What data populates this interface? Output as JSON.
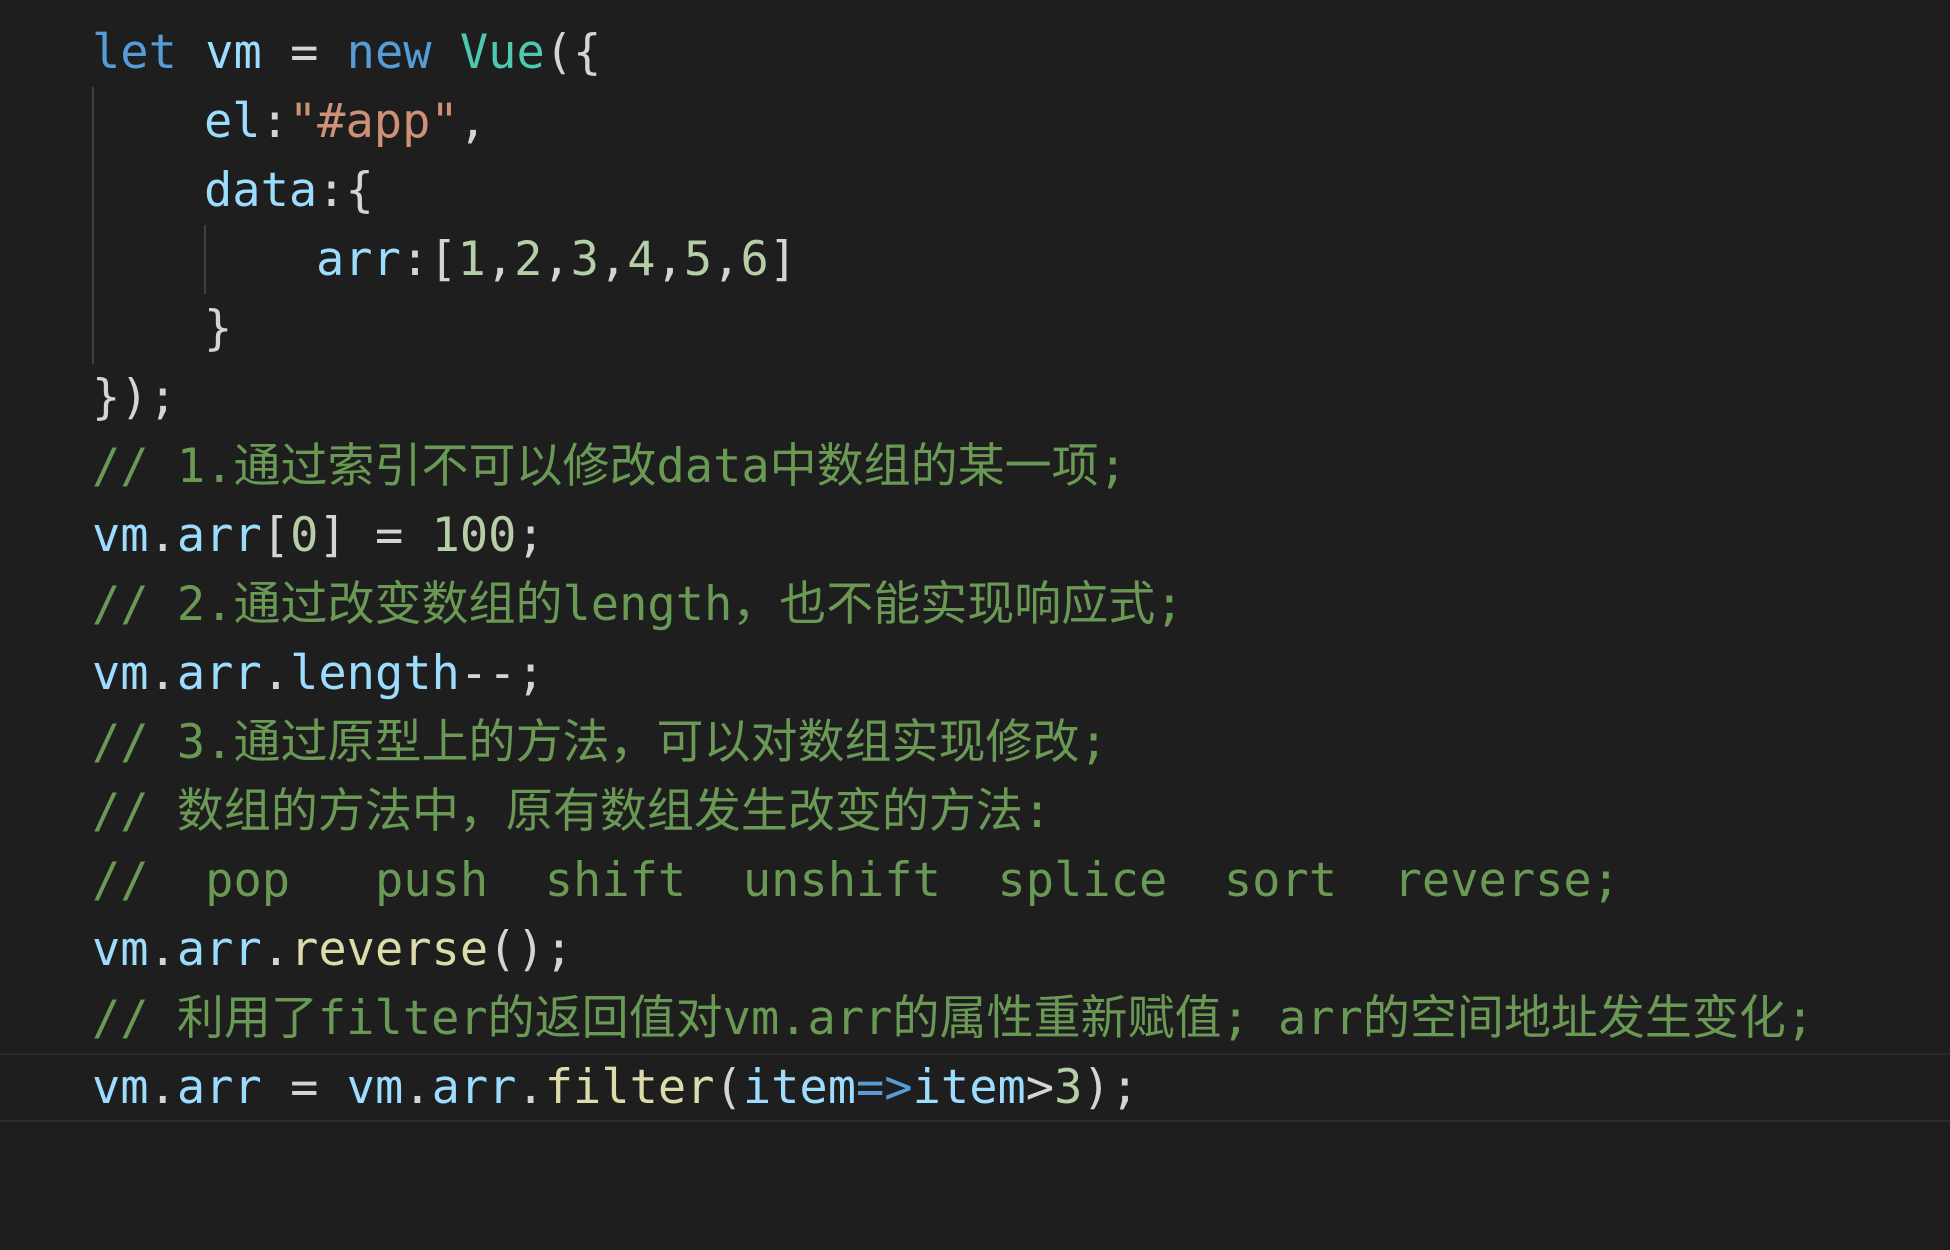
{
  "editor": {
    "theme_colors": {
      "background": "#1e1e1e",
      "keyword": "#569cd6",
      "class_name": "#4ec9b0",
      "string": "#ce9178",
      "number": "#b5cea8",
      "variable": "#9cdcfe",
      "function": "#dcdcaa",
      "comment": "#6a9955",
      "punctuation": "#d4d4d4"
    },
    "lines": {
      "l1": {
        "let": "let",
        "vm": "vm",
        "eq": " = ",
        "new": "new",
        "vue": "Vue",
        "tail": "({"
      },
      "l2": {
        "key": "el",
        "colon": ":",
        "str": "\"#app\"",
        "comma": ","
      },
      "l3": {
        "key": "data",
        "tail": ":{"
      },
      "l4": {
        "key": "arr",
        "open": ":[",
        "nums": [
          "1",
          "2",
          "3",
          "4",
          "5",
          "6"
        ],
        "sep": ",",
        "close": "]"
      },
      "l5": {
        "brace": "}"
      },
      "l6": {
        "text": "});"
      },
      "l7": {
        "comment": "// 1.通过索引不可以修改data中数组的某一项;"
      },
      "l8": {
        "vm": "vm",
        "dot": ".",
        "arr": "arr",
        "open": "[",
        "idx": "0",
        "close": "]",
        "eq": " = ",
        "val": "100",
        "semi": ";"
      },
      "l9": {
        "comment": "// 2.通过改变数组的length，也不能实现响应式;"
      },
      "l10": {
        "vm": "vm",
        "dot": ".",
        "arr": "arr",
        "dot2": ".",
        "prop": "length",
        "tail": "--;"
      },
      "l11": {
        "comment": "// 3.通过原型上的方法，可以对数组实现修改;"
      },
      "l12": {
        "comment": "// 数组的方法中，原有数组发生改变的方法:"
      },
      "l13": {
        "comment": "//  pop   push  shift  unshift  splice  sort  reverse;"
      },
      "l14": {
        "vm": "vm",
        "dot": ".",
        "arr": "arr",
        "dot2": ".",
        "fn": "reverse",
        "tail": "();"
      },
      "l15": {
        "comment": "// 利用了filter的返回值对vm.arr的属性重新赋值; arr的空间地址发生变化;"
      },
      "l16": {
        "vm": "vm",
        "dot": ".",
        "arr": "arr",
        "eq": " = ",
        "vm2": "vm",
        "dot2": ".",
        "arr2": "arr",
        "dot3": ".",
        "fn": "filter",
        "open": "(",
        "p1": "item",
        "arrow": "=>",
        "p2": "item",
        "gt": ">",
        "n": "3",
        "tail": ");"
      }
    }
  }
}
